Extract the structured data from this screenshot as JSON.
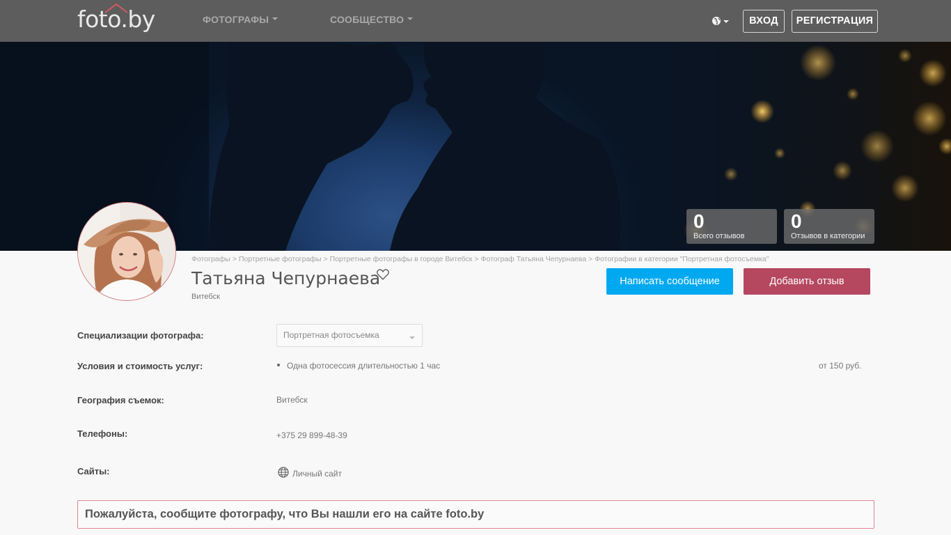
{
  "header": {
    "logo_text": "foto.by",
    "nav": [
      {
        "label": "ФОТОГРАФЫ"
      },
      {
        "label": "СООБЩЕСТВО"
      }
    ],
    "login_label": "ВХОД",
    "register_label": "РЕГИСТРАЦИЯ",
    "lang_icon": "globe-icon"
  },
  "stats": [
    {
      "value": "0",
      "label": "Всего отзывов"
    },
    {
      "value": "0",
      "label": "Отзывов в категории"
    }
  ],
  "breadcrumb": [
    "Фотографы",
    "Портретные фотографы",
    "Портретные фотографы в городе Витебск",
    "Фотограф Татьяна Чепурнаева",
    "Фотографии в категории \"Портретная фотосъемка\""
  ],
  "breadcrumb_separator": ">",
  "profile": {
    "name": "Татьяна Чепурнаева",
    "city": "Витебск",
    "message_button": "Написать сообщение",
    "review_button": "Добавить отзыв"
  },
  "details": {
    "specializations_label": "Специализации фотографа:",
    "specialization_selected": "Портретная фотосъемка",
    "services_label": "Условия и стоимость услуг:",
    "service_item": "Одна фотосессия длительностью 1 час",
    "service_price": "от 150 руб.",
    "geography_label": "География съемок:",
    "geography_value": "Витебск",
    "phones_label": "Телефоны:",
    "phone_value": "+375 29 899-48-39",
    "sites_label": "Сайты:",
    "site_value": "Личный сайт"
  },
  "notice": "Пожалуйста, сообщите фотографу, что Вы нашли его на сайте foto.by",
  "colors": {
    "header_bg": "#5d5d5d",
    "message_button": "#00a8f0",
    "review_button": "#b5475f",
    "notice_border": "#e1878c"
  }
}
